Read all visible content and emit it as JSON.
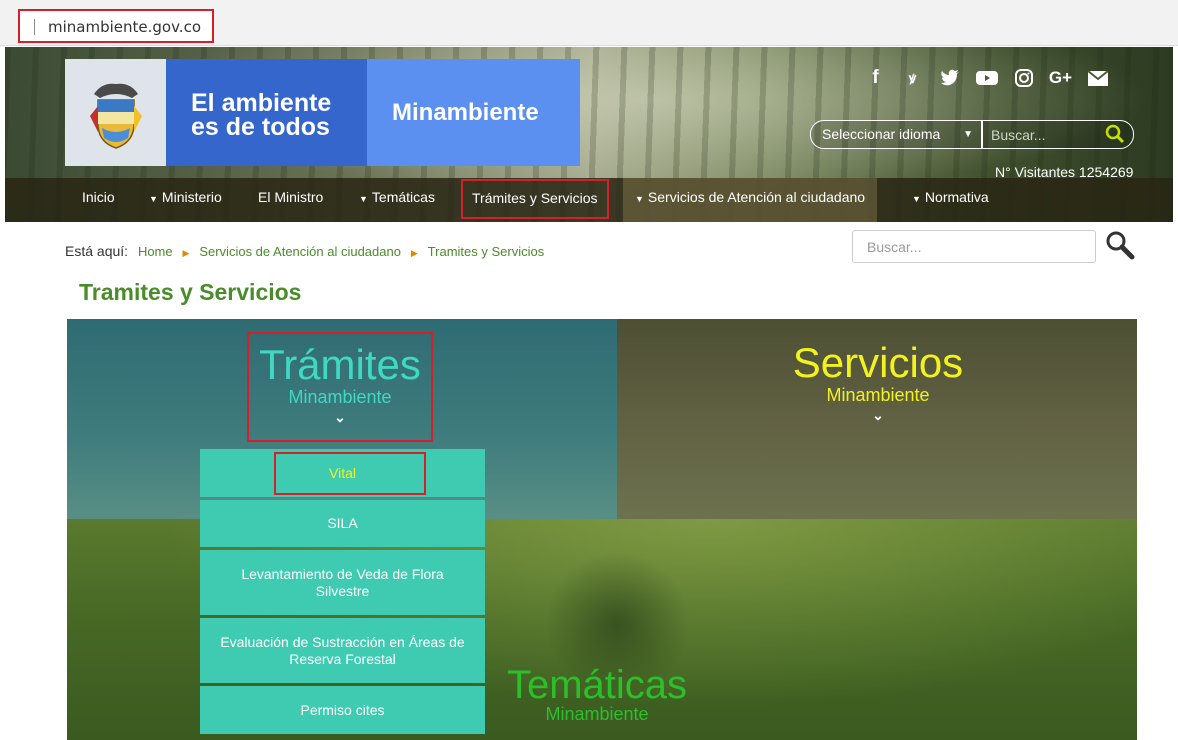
{
  "browser": {
    "url": "minambiente.gov.co"
  },
  "header": {
    "logo_line1": "El ambiente",
    "logo_line2": "es de todos",
    "logo_brand": "Minambiente",
    "social_icons": [
      "facebook-icon",
      "flickr-icon",
      "twitter-icon",
      "youtube-icon",
      "instagram-icon",
      "google-plus-icon",
      "mail-icon"
    ],
    "language_select": "Seleccionar idioma",
    "search_placeholder": "Buscar...",
    "visitors": "N° Visitantes 1254269"
  },
  "nav": {
    "items": [
      {
        "label": "Inicio",
        "caret": false
      },
      {
        "label": "Ministerio",
        "caret": true
      },
      {
        "label": "El Ministro",
        "caret": false
      },
      {
        "label": "Temáticas",
        "caret": true
      },
      {
        "label": "Trámites y Servicios",
        "caret": false
      },
      {
        "label": "Servicios de Atención al ciudadano",
        "caret": true
      },
      {
        "label": "Normativa",
        "caret": true
      }
    ]
  },
  "breadcrumb": {
    "prefix": "Está aquí:",
    "items": [
      "Home",
      "Servicios de Atención al ciudadano",
      "Tramites y Servicios"
    ]
  },
  "body_search_placeholder": "Buscar...",
  "page_title": "Tramites y Servicios",
  "hero": {
    "tramites": {
      "title": "Trámites",
      "subtitle": "Minambiente"
    },
    "servicios": {
      "title": "Servicios",
      "subtitle": "Minambiente"
    },
    "tematicas": {
      "title": "Temáticas",
      "subtitle": "Minambiente"
    },
    "tramites_menu": [
      "Vital",
      "SILA",
      "Levantamiento de Veda de Flora Silvestre",
      "Evaluación de Sustracción en Áreas de Reserva Forestal",
      "Permiso cites"
    ]
  },
  "colors": {
    "brand_green": "#4a8b2a",
    "highlight_red": "#d3202a",
    "teal": "#3ecbb1",
    "yellow": "#f2f21f"
  }
}
